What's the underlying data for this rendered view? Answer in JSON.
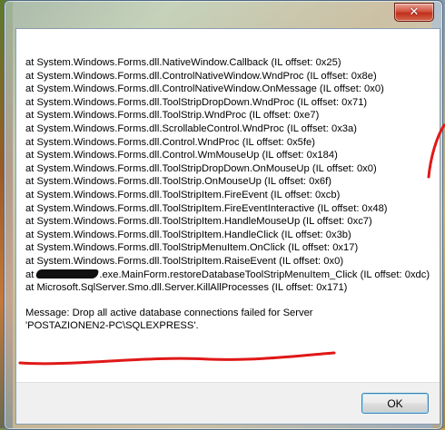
{
  "dialog": {
    "close_icon": "close-icon",
    "stack_lines": [
      "at System.Windows.Forms.dll.NativeWindow.Callback  (IL offset: 0x25)",
      "at System.Windows.Forms.dll.ControlNativeWindow.WndProc  (IL offset: 0x8e)",
      "at System.Windows.Forms.dll.ControlNativeWindow.OnMessage  (IL offset: 0x0)",
      "at System.Windows.Forms.dll.ToolStripDropDown.WndProc  (IL offset: 0x71)",
      "at System.Windows.Forms.dll.ToolStrip.WndProc  (IL offset: 0xe7)",
      "at System.Windows.Forms.dll.ScrollableControl.WndProc  (IL offset: 0x3a)",
      "at System.Windows.Forms.dll.Control.WndProc  (IL offset: 0x5fe)",
      "at System.Windows.Forms.dll.Control.WmMouseUp  (IL offset: 0x184)",
      "at System.Windows.Forms.dll.ToolStripDropDown.OnMouseUp  (IL offset: 0x0)",
      "at System.Windows.Forms.dll.ToolStrip.OnMouseUp  (IL offset: 0x6f)",
      "at System.Windows.Forms.dll.ToolStripItem.FireEvent  (IL offset: 0xcb)",
      "at System.Windows.Forms.dll.ToolStripItem.FireEventInteractive  (IL offset: 0x48)",
      "at System.Windows.Forms.dll.ToolStripItem.HandleMouseUp  (IL offset: 0xc7)",
      "at System.Windows.Forms.dll.ToolStripItem.HandleClick  (IL offset: 0x3b)",
      "at System.Windows.Forms.dll.ToolStripMenuItem.OnClick  (IL offset: 0x17)",
      "at System.Windows.Forms.dll.ToolStripItem.RaiseEvent  (IL offset: 0x0)"
    ],
    "redacted_line_prefix": "at",
    "redacted_line_rest": ".exe.MainForm.restoreDatabaseToolStripMenuItem_Click  (IL offset: 0xdc)",
    "smo_line": "at Microsoft.SqlServer.Smo.dll.Server.KillAllProcesses  (IL offset: 0x171)",
    "message_line1": "Message: Drop all active database connections failed for Server",
    "message_line2": "'POSTAZIONEN2-PC\\SQLEXPRESS'.",
    "ok_label": "OK"
  }
}
